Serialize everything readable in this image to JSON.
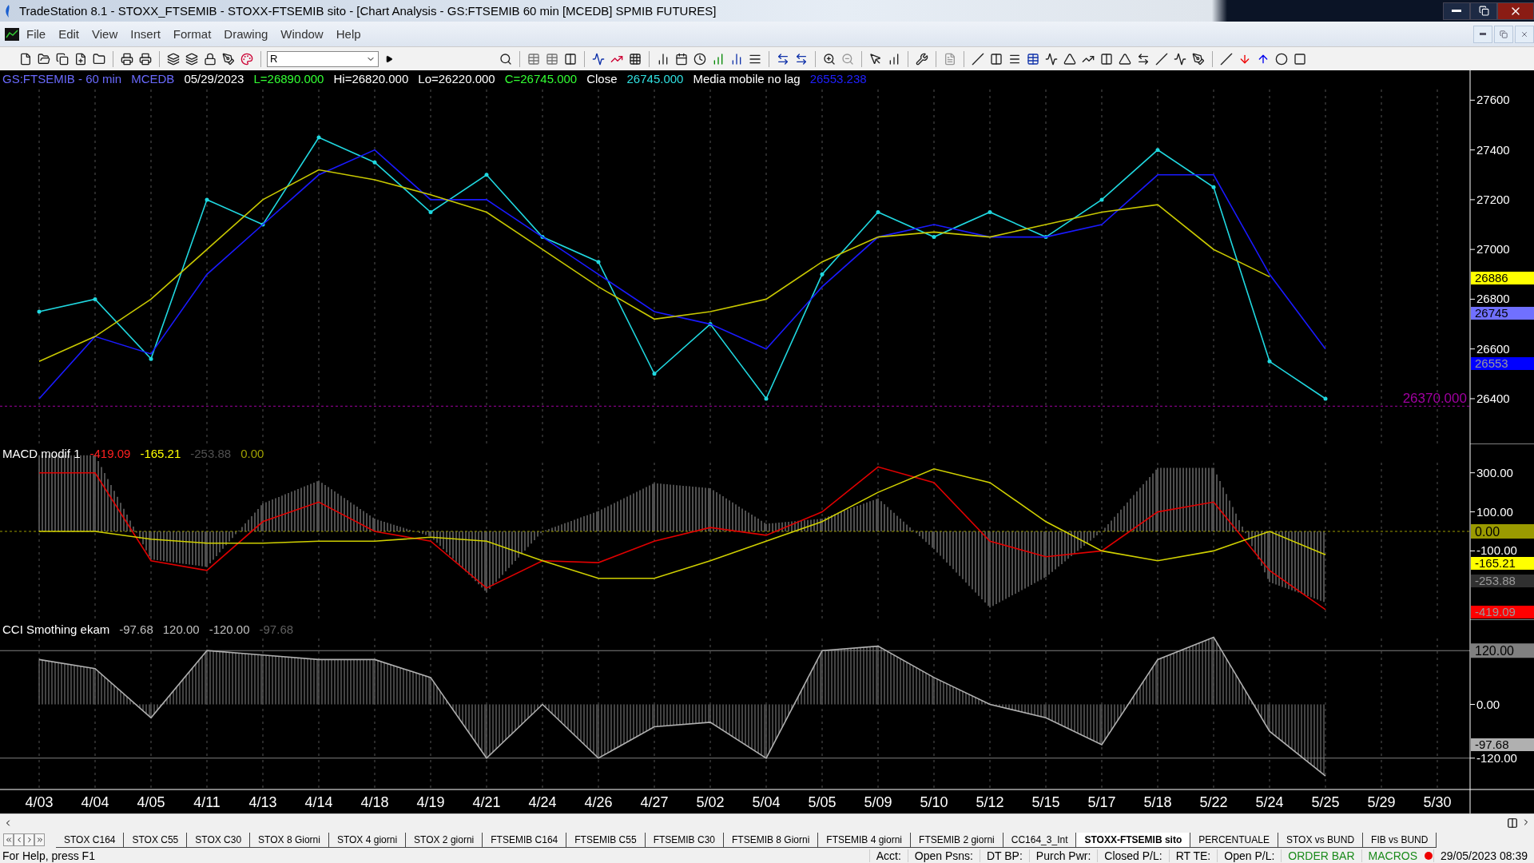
{
  "window": {
    "title": "TradeStation 8.1 - STOXX_FTSEMIB - STOXX-FTSEMIB sito - [Chart Analysis - GS:FTSEMIB  60 min  [MCEDB] SPMIB FUTURES]"
  },
  "menu": [
    "File",
    "Edit",
    "View",
    "Insert",
    "Format",
    "Drawing",
    "Window",
    "Help"
  ],
  "toolbar": {
    "combo": {
      "value": "R"
    }
  },
  "panes": [
    {
      "legend": [
        {
          "text": "GS:FTSEMIB - 60 min",
          "color": "#6a6aff"
        },
        {
          "text": "MCEDB",
          "color": "#6a6aff"
        },
        {
          "text": "05/29/2023",
          "color": "#ffffff"
        },
        {
          "text": "L=26890.000",
          "color": "#33ff33"
        },
        {
          "text": "Hi=26820.000",
          "color": "#ffffff"
        },
        {
          "text": "Lo=26220.000",
          "color": "#ffffff"
        },
        {
          "text": "C=26745.000",
          "color": "#33ff33"
        },
        {
          "text": "Close",
          "color": "#ffffff"
        },
        {
          "text": "26745.000",
          "color": "#30e0e0"
        },
        {
          "text": "Media mobile no lag",
          "color": "#ffffff"
        },
        {
          "text": "26553.238",
          "color": "#2020ff"
        }
      ],
      "axis_markers": [
        {
          "text": "26886",
          "color": "#ffff00"
        },
        {
          "text": "26745",
          "color": "#7070ff"
        },
        {
          "text": "26553",
          "color": "#0000ff"
        }
      ],
      "chart_data": {
        "type": "line",
        "grid": true,
        "ylim": [
          26220,
          27720
        ],
        "yticks": [
          27600,
          27400,
          27200,
          27000,
          26800,
          26600,
          26400
        ],
        "series": [
          {
            "color": "#20d8e0",
            "values": [
              26750,
              26800,
              26560,
              27200,
              27100,
              27450,
              27350,
              27150,
              27300,
              27050,
              26950,
              26500,
              26700,
              26400,
              26900,
              27150,
              27050,
              27150,
              27050,
              27200,
              27400,
              27250,
              26550,
              26400,
              null,
              null
            ]
          },
          {
            "color": "#1a1aff",
            "values": [
              26400,
              26650,
              26580,
              26900,
              27100,
              27300,
              27400,
              27200,
              27200,
              27050,
              26900,
              26750,
              26700,
              26600,
              26850,
              27050,
              27100,
              27050,
              27050,
              27100,
              27300,
              27300,
              26900,
              26600,
              null,
              null
            ]
          },
          {
            "color": "#c8c800",
            "values": [
              26550,
              26650,
              26800,
              27000,
              27200,
              27320,
              27280,
              27220,
              27150,
              27000,
              26850,
              26720,
              26750,
              26800,
              26950,
              27050,
              27070,
              27050,
              27100,
              27150,
              27180,
              27000,
              26890,
              null,
              null,
              null
            ]
          }
        ],
        "ref_lines": [
          {
            "axis": "y",
            "value": 26370,
            "label": "26370.000",
            "color": "#a000a0"
          }
        ]
      }
    },
    {
      "legend": [
        {
          "text": "MACD modif 1",
          "color": "#ffffff"
        },
        {
          "text": "-419.09",
          "color": "#ff2020"
        },
        {
          "text": "-165.21",
          "color": "#ffff00"
        },
        {
          "text": "-253.88",
          "color": "#505050"
        },
        {
          "text": "0.00",
          "color": "#a0a000"
        }
      ],
      "axis_markers": [
        {
          "text": "-165.21",
          "color": "#ffff00"
        },
        {
          "text": "-253.88",
          "color": "#303030"
        },
        {
          "text": "-419.09",
          "color": "#ff0000"
        }
      ],
      "chart_data": {
        "type": "line",
        "grid": true,
        "ylim": [
          -450,
          450
        ],
        "yticks": [
          {
            "value": 300,
            "label": "300.00"
          },
          {
            "value": 100,
            "label": "100.00"
          },
          {
            "value": -100,
            "label": "-100.00"
          }
        ],
        "series": [
          {
            "color": "#e00000",
            "values": [
              300,
              300,
              -150,
              -200,
              50,
              150,
              0,
              -50,
              -290,
              -150,
              -160,
              -50,
              20,
              -20,
              100,
              330,
              250,
              -50,
              -130,
              -100,
              100,
              150,
              -200,
              -400,
              null,
              null
            ]
          },
          {
            "color": "#d0d000",
            "values": [
              0,
              0,
              -40,
              -60,
              -60,
              -50,
              -50,
              -30,
              -50,
              -150,
              -240,
              -240,
              -150,
              -50,
              50,
              200,
              320,
              250,
              50,
              -100,
              -150,
              -100,
              0,
              -120,
              null,
              null
            ]
          }
        ],
        "ref_lines": [
          {
            "axis": "y",
            "value": 0,
            "label": "0.00",
            "color": "#9a9a00"
          }
        ]
      }
    },
    {
      "legend": [
        {
          "text": "CCI Smothing ekam",
          "color": "#ffffff"
        },
        {
          "text": "-97.68",
          "color": "#c0c0c0"
        },
        {
          "text": "120.00",
          "color": "#c0c0c0"
        },
        {
          "text": "-120.00",
          "color": "#c0c0c0"
        },
        {
          "text": "-97.68",
          "color": "#606060"
        }
      ],
      "axis_markers": [
        {
          "text": "-97.68",
          "color": "#b0b0b0"
        }
      ],
      "chart_data": {
        "type": "line",
        "grid": true,
        "ylim": [
          -190,
          190
        ],
        "yticks": [
          {
            "value": 0,
            "label": "0.00"
          },
          {
            "value": -120,
            "label": "-120.00"
          }
        ],
        "categories": [
          "4/03",
          "4/04",
          "4/05",
          "4/11",
          "4/13",
          "4/14",
          "4/18",
          "4/19",
          "4/21",
          "4/24",
          "4/26",
          "4/27",
          "5/02",
          "5/04",
          "5/05",
          "5/09",
          "5/10",
          "5/12",
          "5/15",
          "5/17",
          "5/18",
          "5/22",
          "5/24",
          "5/25",
          "5/29",
          "5/30"
        ],
        "series": [
          {
            "color": "#b0b0b0",
            "values": [
              100,
              80,
              -30,
              120,
              110,
              100,
              100,
              60,
              -120,
              0,
              -120,
              -50,
              -40,
              -120,
              120,
              130,
              60,
              0,
              -30,
              -90,
              100,
              150,
              -60,
              -160,
              null,
              null
            ]
          }
        ],
        "ref_lines": [
          {
            "axis": "y",
            "value": 120,
            "label": "120.00",
            "color": "#808080"
          },
          {
            "axis": "y",
            "value": -120,
            "color": "#808080"
          }
        ]
      }
    }
  ],
  "tabs": [
    {
      "label": "STOX C164",
      "selected": false
    },
    {
      "label": "STOX C55",
      "selected": false
    },
    {
      "label": "STOX  C30",
      "selected": false
    },
    {
      "label": "STOX  8 Giorni",
      "selected": false
    },
    {
      "label": "STOX 4 giorni",
      "selected": false
    },
    {
      "label": "STOX  2 giorni",
      "selected": false
    },
    {
      "label": "FTSEMIB C164",
      "selected": false
    },
    {
      "label": "FTSEMIB C55",
      "selected": false
    },
    {
      "label": "FTSEMIB C30",
      "selected": false
    },
    {
      "label": "FTSEMIB  8 Giorni",
      "selected": false
    },
    {
      "label": "FTSEMIB  4 giorni",
      "selected": false
    },
    {
      "label": "FTSEMIB  2 giorni",
      "selected": false
    },
    {
      "label": "CC164_3_Int",
      "selected": false
    },
    {
      "label": "STOXX-FTSEMIB sito",
      "selected": true
    },
    {
      "label": "PERCENTUALE",
      "selected": false
    },
    {
      "label": "STOX vs BUND",
      "selected": false
    },
    {
      "label": "FIB vs BUND",
      "selected": false
    }
  ],
  "status_bar": {
    "help": "For Help, press F1",
    "fields": [
      {
        "text": "Acct:",
        "kind": "plain"
      },
      {
        "text": "Open Psns:",
        "kind": "plain"
      },
      {
        "text": "DT BP:",
        "kind": "plain"
      },
      {
        "text": "Purch Pwr:",
        "kind": "plain"
      },
      {
        "text": "Closed P/L:",
        "kind": "plain"
      },
      {
        "text": "RT TE:",
        "kind": "plain"
      },
      {
        "text": "Open P/L:",
        "kind": "plain"
      },
      {
        "text": "ORDER BAR",
        "kind": "link"
      },
      {
        "text": "MACROS",
        "kind": "link"
      },
      {
        "text": "29/05/2023 08:39",
        "kind": "clock"
      }
    ]
  }
}
